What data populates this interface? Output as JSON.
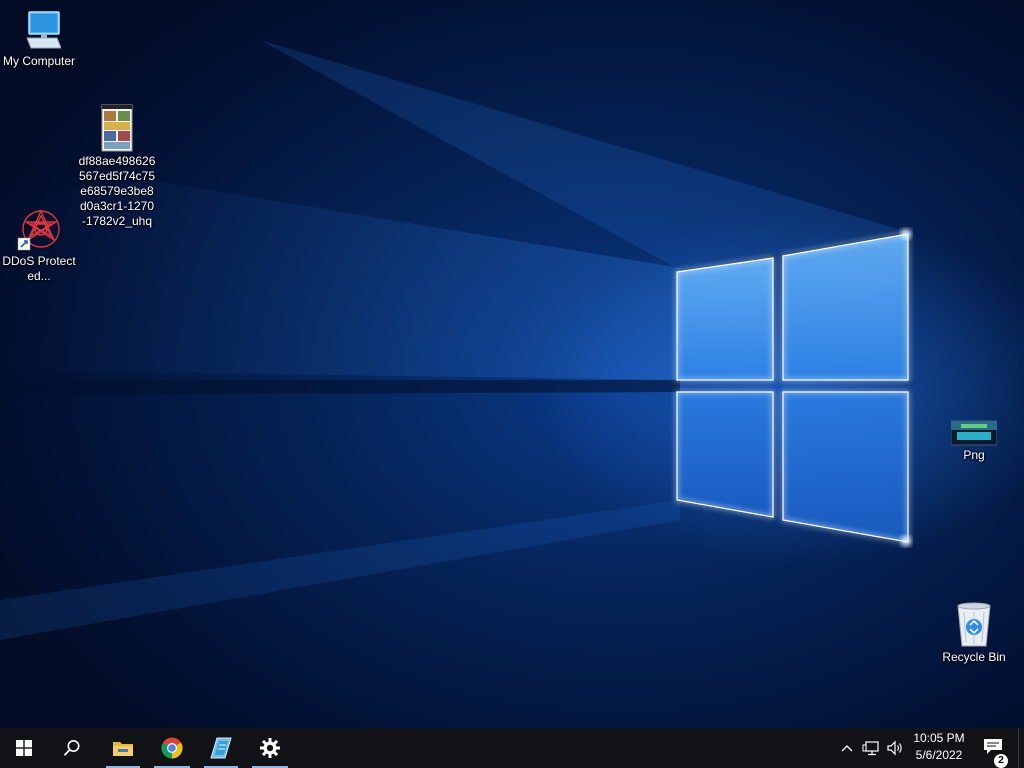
{
  "desktop": {
    "icons": [
      {
        "label": "My Computer",
        "icon": "computer-icon"
      },
      {
        "label": "df88ae498626567ed5f74c75e68579e3be8d0a3cr1-1270-1782v2_uhq",
        "icon": "image-file-icon"
      },
      {
        "label": "DDoS Protected...",
        "icon": "shortcut-app-icon"
      },
      {
        "label": "Png",
        "icon": "image-file-icon"
      },
      {
        "label": "Recycle Bin",
        "icon": "recycle-bin-icon"
      }
    ]
  },
  "taskbar": {
    "pinned": [
      {
        "name": "start",
        "icon": "windows-logo-icon"
      },
      {
        "name": "search",
        "icon": "search-icon"
      },
      {
        "name": "file-explorer",
        "icon": "folder-icon"
      },
      {
        "name": "chrome",
        "icon": "chrome-icon"
      },
      {
        "name": "app",
        "icon": "notepad-icon"
      },
      {
        "name": "settings",
        "icon": "gear-icon"
      }
    ],
    "clock": {
      "time": "10:05 PM",
      "date": "5/6/2022"
    },
    "notifications": {
      "count": "2"
    }
  },
  "colors": {
    "taskbar": "#101216",
    "wallpaper_glow": "#2f8ff0",
    "running_indicator": "#8fb8e8"
  }
}
